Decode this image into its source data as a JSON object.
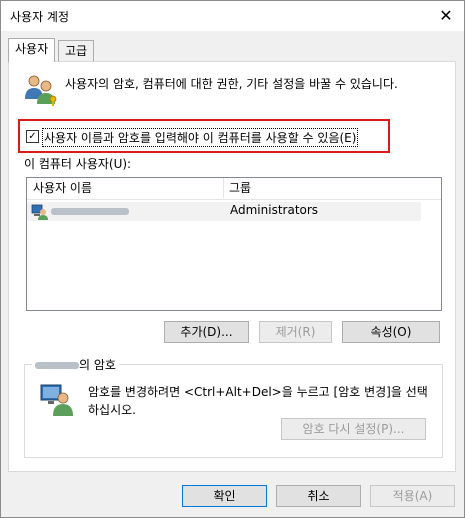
{
  "window": {
    "title": "사용자 계정",
    "close_glyph": "✕"
  },
  "tabs": [
    {
      "label": "사용자"
    },
    {
      "label": "고급"
    }
  ],
  "description": "사용자의 암호, 컴퓨터에 대한 권한, 기타 설정을 바꿀 수 있습니다.",
  "require_login": {
    "label": "사용자 이름과 암호를 입력해야 이 컴퓨터를 사용할 수 있음(E)",
    "checked": true,
    "check_glyph": "✓"
  },
  "users_list": {
    "label": "이 컴퓨터 사용자(U):",
    "columns": [
      "사용자 이름",
      "그룹"
    ],
    "rows": [
      {
        "group": "Administrators"
      }
    ]
  },
  "list_buttons": {
    "add": "추가(D)...",
    "remove": "제거(R)",
    "properties": "속성(O)"
  },
  "password_group": {
    "title_suffix": "의 암호",
    "text": "암호를 변경하려면 <Ctrl+Alt+Del>을 누르고 [암호 변경]을 선택하십시오.",
    "reset_button": "암호 다시 설정(P)..."
  },
  "footer": {
    "ok": "확인",
    "cancel": "취소",
    "apply": "적용(A)"
  },
  "colors": {
    "highlight_border": "#e01818",
    "accent": "#0078d7"
  },
  "icons": {
    "users": "users-icon",
    "user": "user-icon",
    "password": "password-icon"
  }
}
